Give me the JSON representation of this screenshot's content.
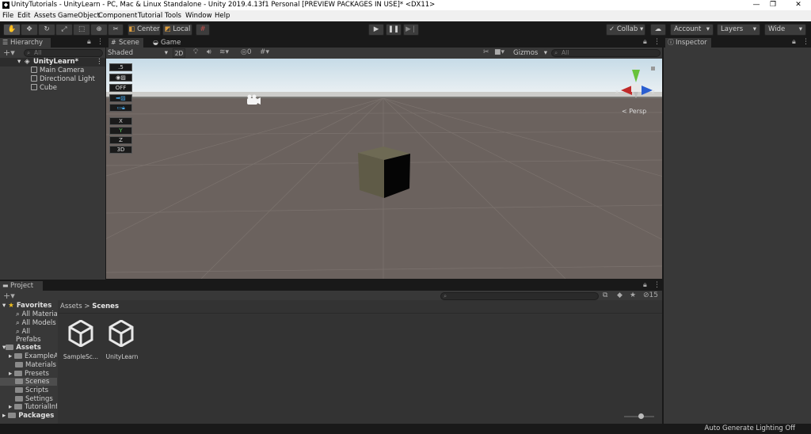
{
  "window": {
    "title": "UnityTutorials - UnityLearn - PC, Mac & Linux Standalone - Unity 2019.4.13f1 Personal [PREVIEW PACKAGES IN USE]* <DX11>",
    "minimize": "—",
    "maximize": "❐",
    "close": "✕"
  },
  "menu": [
    "File",
    "Edit",
    "Assets",
    "GameObject",
    "Component",
    "Tutorial",
    "Tools",
    "Window",
    "Help"
  ],
  "toolbar": {
    "center_label": "Center",
    "local_label": "Local",
    "collab_label": "Collab ▾",
    "account_label": "Account",
    "layers_label": "Layers",
    "layout_label": "Wide"
  },
  "hierarchy": {
    "tab_label": "Hierarchy",
    "search_placeholder": "All",
    "scene_name": "UnityLearn*",
    "objects": [
      "Main Camera",
      "Directional Light",
      "Cube"
    ]
  },
  "scene": {
    "tabs": [
      "Scene",
      "Game"
    ],
    "shading_mode": "Shaded",
    "mode_2d": "2D",
    "hidden_count": "0",
    "gizmos_label": "Gizmos",
    "search_placeholder": "All",
    "persp_label": "< Persp",
    "overlay_buttons": [
      ".5",
      "OFF",
      "X",
      "Y",
      "Z",
      "3D"
    ]
  },
  "inspector": {
    "tab_label": "Inspector"
  },
  "project": {
    "tab_label": "Project",
    "favorites_label": "Favorites",
    "favorites": [
      "All Materials",
      "All Models",
      "All Prefabs"
    ],
    "assets_label": "Assets",
    "folders": [
      "ExampleAssets",
      "Materials",
      "Presets",
      "Scenes",
      "Scripts",
      "Settings",
      "TutorialInfo"
    ],
    "packages_label": "Packages",
    "breadcrumb": [
      "Assets",
      "Scenes"
    ],
    "breadcrumb_sep": ">",
    "hidden_count": "15",
    "assets": [
      "SampleSc...",
      "UnityLearn"
    ]
  },
  "status": {
    "lighting_text": "Auto Generate Lighting Off"
  },
  "colors": {
    "selected_folder": "#4d4d4d",
    "accent_blue": "#2d8ccd"
  }
}
